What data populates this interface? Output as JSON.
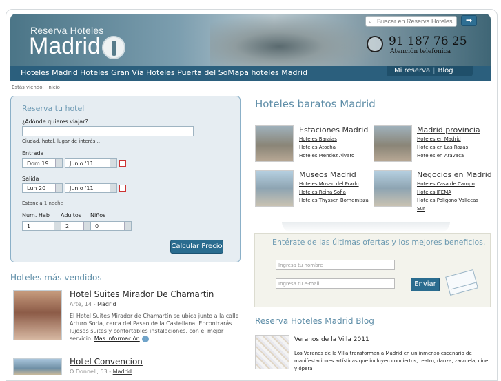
{
  "header": {
    "logo_top": "Reserva Hoteles",
    "logo_main": "Madrid",
    "search_placeholder": "Buscar en Reserva Hoteles",
    "search_button": "➡",
    "phone": "91 187 76 25",
    "phone_sub": "Atención telefónica"
  },
  "nav": {
    "items": [
      "Hoteles Madrid",
      "Hoteles Gran Vía",
      "Hoteles Puerta del Sol",
      "Mapa hoteles Madrid"
    ],
    "my_reservation": "Mi reserva",
    "blog": "Blog"
  },
  "breadcrumb": {
    "label": "Estás viendo:",
    "current": "Inicio"
  },
  "booking": {
    "title": "Reserva tu hotel",
    "destination_label": "¿Adónde quieres viajar?",
    "destination_value": "",
    "destination_hint": "Ciudad, hotel, lugar de interés...",
    "checkin_label": "Entrada",
    "checkin_day": "Dom 19",
    "checkin_month": "Junio '11",
    "checkout_label": "Salida",
    "checkout_day": "Lun 20",
    "checkout_month": "Junio '11",
    "stay_label": "Estancia",
    "stay_value": "1 noche",
    "rooms_label": "Num. Hab",
    "adults_label": "Adultos",
    "children_label": "Niños",
    "rooms_value": "1",
    "adults_value": "2",
    "children_value": "0",
    "calc_button": "Calcular Precio"
  },
  "bestsellers": {
    "title": "Hoteles más vendidos",
    "hotels": [
      {
        "name": "Hotel Suites Mirador De Chamartin",
        "address": "Arte, 14 - ",
        "city": "Madrid",
        "description": "El Hotel Suites Mirador de Chamartín se ubica junto a la calle Arturo Soria, cerca del Paseo de la Castellana. Encontrarás lujosas suites y confortables instalaciones, con el mejor servicio. ",
        "more": "Mas información"
      },
      {
        "name": "Hotel Convencion",
        "address": "O Donnell, 53 - ",
        "city": "Madrid"
      }
    ]
  },
  "cheap": {
    "title": "Hoteles baratos Madrid",
    "categories": [
      {
        "head": "Estaciones Madrid",
        "links": [
          "Hoteles Barajas",
          "Hoteles Atocha",
          "Hoteles Mendez Alvaro"
        ]
      },
      {
        "head": "Madrid provincia",
        "links": [
          "Hoteles en Madrid",
          "Hoteles en Las Rozas",
          "Hoteles en Aravaca"
        ]
      },
      {
        "head": "Museos Madrid",
        "links": [
          "Hoteles Museo del Prado",
          "Hoteles Reina Sofia",
          "Hoteles Thyssen Bornemisza"
        ]
      },
      {
        "head": "Negocios en Madrid",
        "links": [
          "Hoteles Casa de Campo",
          "Hoteles IFEMA",
          "Hoteles Poligono Vallecas",
          "Sur"
        ]
      }
    ]
  },
  "newsletter": {
    "title": "Entérate de las últimas ofertas y los mejores beneficios.",
    "name_placeholder": "Ingresa tu nombre",
    "email_placeholder": "Ingresa tu e-mail",
    "button": "Enviar"
  },
  "blog": {
    "title": "Reserva Hoteles Madrid Blog",
    "post_title": "Veranos de la Villa 2011",
    "post_excerpt": "Los Veranos de la Villa transforman a Madrid en un inmenso escenario de manifestaciones artísticas que incluyen conciertos, teatro, danza, zarzuela, cine y ópera"
  }
}
